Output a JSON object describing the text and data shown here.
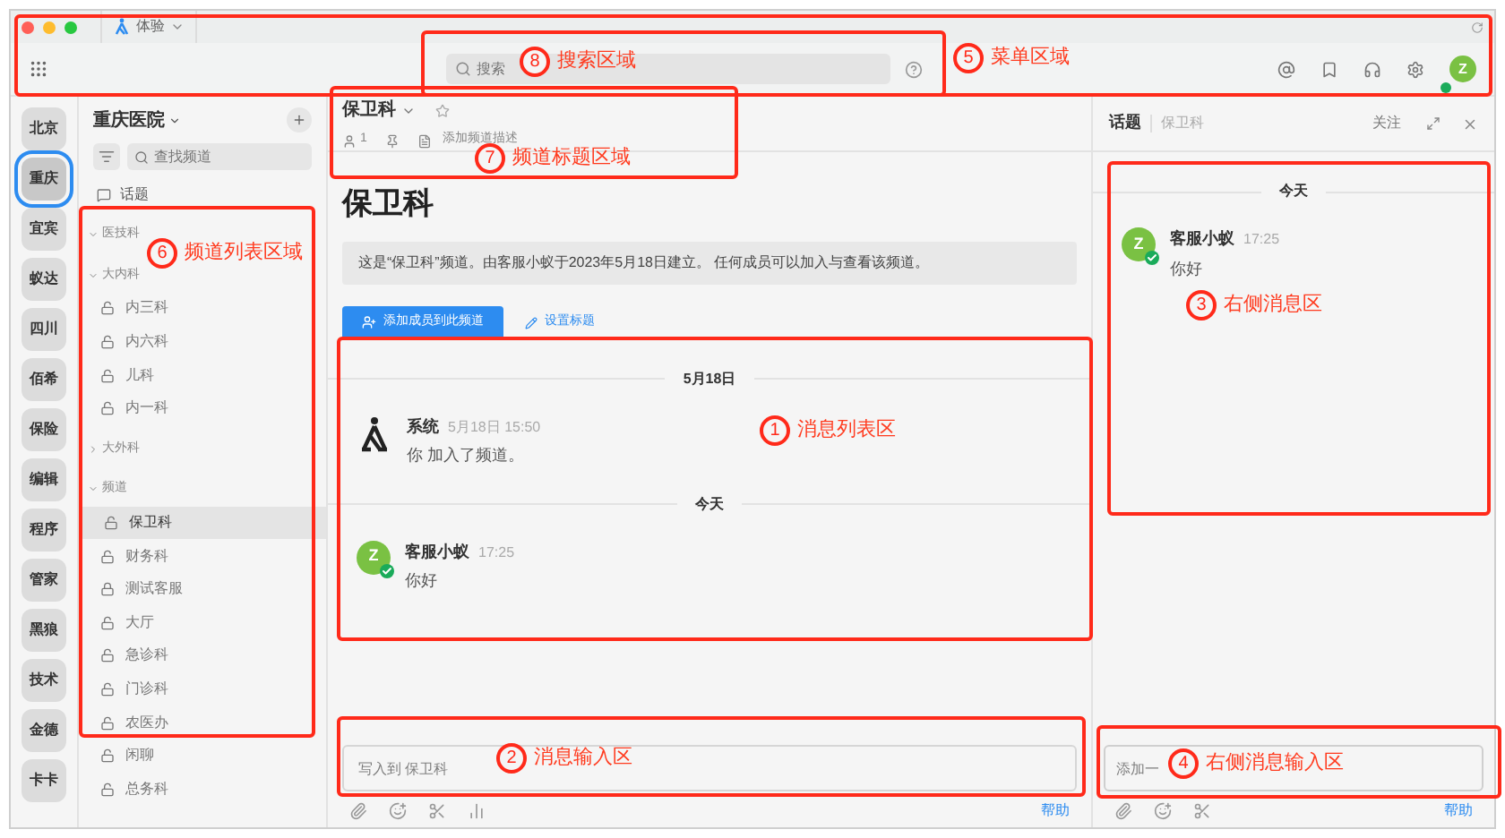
{
  "titlebar": {
    "app_tab": "体验"
  },
  "search": {
    "placeholder": "搜索"
  },
  "user": {
    "avatar": "Z",
    "online": true
  },
  "workspaces": [
    {
      "label": "北京",
      "selected": false
    },
    {
      "label": "重庆",
      "selected": true
    },
    {
      "label": "宜宾",
      "selected": false
    },
    {
      "label": "蚁达",
      "selected": false
    },
    {
      "label": "四川",
      "selected": false
    },
    {
      "label": "佰希",
      "selected": false
    },
    {
      "label": "保险",
      "selected": false
    },
    {
      "label": "编辑",
      "selected": false
    },
    {
      "label": "程序",
      "selected": false
    },
    {
      "label": "管家",
      "selected": false
    },
    {
      "label": "黑狼",
      "selected": false
    },
    {
      "label": "技术",
      "selected": false
    },
    {
      "label": "金德",
      "selected": false
    },
    {
      "label": "卡卡",
      "selected": false
    }
  ],
  "sidebar": {
    "title": "重庆医院",
    "search_placeholder": "查找频道",
    "topics": "话题",
    "groups": [
      {
        "label": "医技科",
        "expanded": true
      },
      {
        "label": "大内科",
        "expanded": true,
        "children": [
          {
            "label": "内三科",
            "locked": false,
            "selected": false
          },
          {
            "label": "内六科",
            "locked": false,
            "selected": false
          },
          {
            "label": "儿科",
            "locked": false,
            "selected": false
          },
          {
            "label": "内一科",
            "locked": false,
            "selected": false
          }
        ]
      },
      {
        "label": "大外科",
        "expanded": false
      },
      {
        "label": "频道",
        "expanded": true,
        "children": [
          {
            "label": "保卫科",
            "locked": false,
            "selected": true
          },
          {
            "label": "财务科",
            "locked": false,
            "selected": false
          },
          {
            "label": "测试客服",
            "locked": true,
            "selected": false
          },
          {
            "label": "大厅",
            "locked": false,
            "selected": false
          },
          {
            "label": "急诊科",
            "locked": false,
            "selected": false
          },
          {
            "label": "门诊科",
            "locked": false,
            "selected": false
          },
          {
            "label": "农医办",
            "locked": false,
            "selected": false
          },
          {
            "label": "闲聊",
            "locked": false,
            "selected": false
          },
          {
            "label": "总务科",
            "locked": false,
            "selected": false
          }
        ]
      }
    ]
  },
  "channel": {
    "name": "保卫科",
    "members": "1",
    "add_description": "添加频道描述",
    "title": "保卫科",
    "intro": "这是“保卫科”频道。由客服小蚁于2023年5月18日建立。 任何成员可以加入与查看该频道。",
    "add_members": "添加成员到此频道",
    "set_title": "设置标题"
  },
  "messages": [
    {
      "kind": "date",
      "label": "5月18日"
    },
    {
      "kind": "system",
      "author": "系统",
      "time": "5月18日 15:50",
      "text": "你 加入了频道。"
    },
    {
      "kind": "date",
      "label": "今天"
    },
    {
      "kind": "message",
      "avatar": "Z",
      "verified": true,
      "author": "客服小蚁",
      "time": "17:25",
      "text": "你好"
    }
  ],
  "composer": {
    "placeholder": "写入到 保卫科",
    "help": "帮助"
  },
  "thread": {
    "title": "话题",
    "channel": "保卫科",
    "follow": "关注",
    "messages": [
      {
        "kind": "date",
        "label": "今天"
      },
      {
        "kind": "message",
        "avatar": "Z",
        "verified": true,
        "author": "客服小蚁",
        "time": "17:25",
        "text": "你好"
      }
    ],
    "composer": {
      "placeholder": "添加一",
      "help": "帮助"
    }
  },
  "annotations": [
    {
      "number": "8",
      "label": "搜索区域"
    },
    {
      "number": "5",
      "label": "菜单区域"
    },
    {
      "number": "7",
      "label": "频道标题区域"
    },
    {
      "number": "6",
      "label": "频道列表区域"
    },
    {
      "number": "3",
      "label": "右侧消息区"
    },
    {
      "number": "1",
      "label": "消息列表区"
    },
    {
      "number": "2",
      "label": "消息输入区"
    },
    {
      "number": "4",
      "label": "右侧消息输入区"
    }
  ]
}
